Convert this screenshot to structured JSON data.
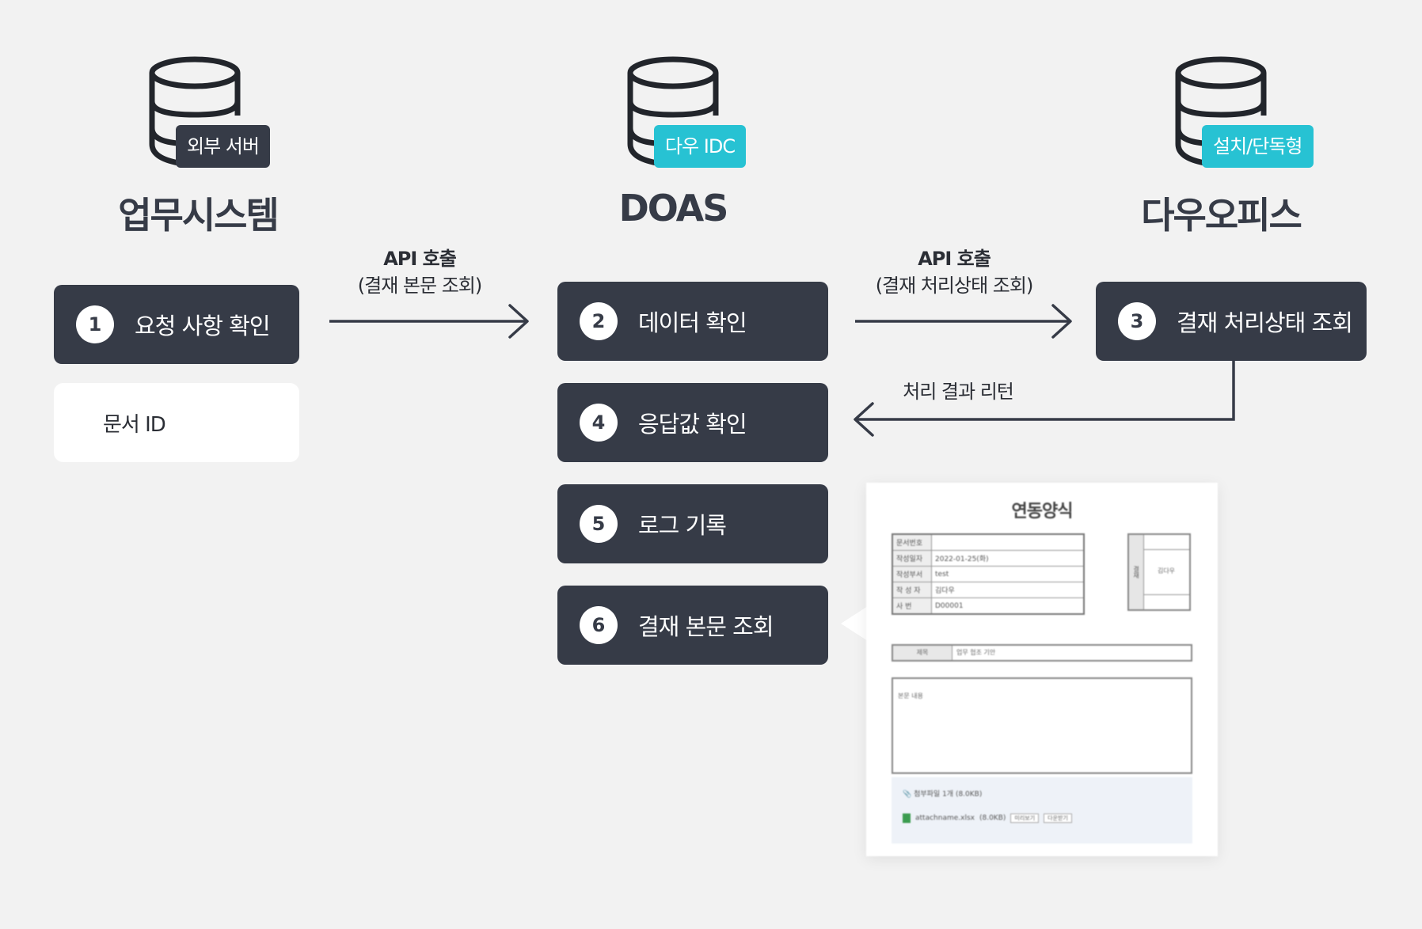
{
  "systems": [
    {
      "badge": "외부 서버",
      "title": "업무시스템"
    },
    {
      "badge": "다우 IDC",
      "title": "DOAS"
    },
    {
      "badge": "설치/단독형",
      "title": "다우오피스"
    }
  ],
  "colors": {
    "dark": "#363b47",
    "teal": "#27c2d3",
    "background": "#f2f2f2"
  },
  "steps": [
    {
      "num": "1",
      "label": "요청 사항 확인"
    },
    {
      "num": "2",
      "label": "데이터 확인"
    },
    {
      "num": "3",
      "label": "결재 처리상태 조회"
    },
    {
      "num": "4",
      "label": "응답값 확인"
    },
    {
      "num": "5",
      "label": "로그 기록"
    },
    {
      "num": "6",
      "label": "결재 본문 조회"
    }
  ],
  "document_id": "문서 ID",
  "arrows": {
    "a1_line1": "API 호출",
    "a1_line2": "(결재 본문 조회)",
    "a2_line1": "API 호출",
    "a2_line2": "(결재 처리상태 조회)",
    "a3": "처리 결과 리턴"
  },
  "form": {
    "title": "연동양식",
    "rows": [
      {
        "label": "문서번호",
        "value": ""
      },
      {
        "label": "작성일자",
        "value": "2022-01-25(화)"
      },
      {
        "label": "작성부서",
        "value": "test"
      },
      {
        "label": "작 성 자",
        "value": "김다우"
      },
      {
        "label": "사    번",
        "value": "D00001"
      }
    ],
    "approval_label": "결재",
    "approver": "김다우",
    "subject_label": "제목",
    "subject_value": "업무 협조 기안",
    "body_text": "본문 내용",
    "attachment_count": "첨부파일 1개 (8.0KB)",
    "attachment_name": "attachname.xlsx",
    "attachment_size": "(8.0KB)",
    "preview_btn": "미리보기",
    "download_btn": "다운받기"
  }
}
